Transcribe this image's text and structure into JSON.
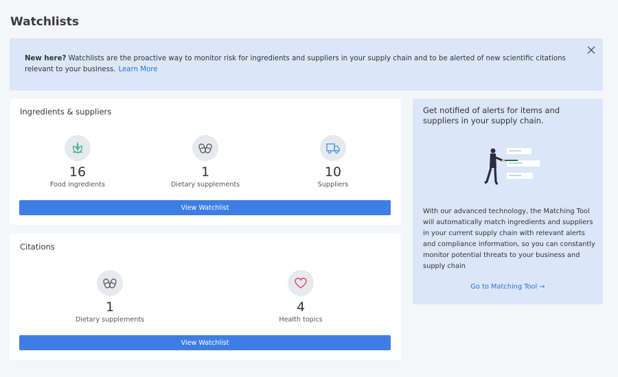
{
  "page": {
    "title": "Watchlists"
  },
  "banner": {
    "bold": "New here?",
    "text": " Watchlists are the proactive way to monitor risk for ingredients and suppliers in your supply chain and to be alerted of new scientific citations relevant to your business.",
    "link": "Learn More"
  },
  "ingredients": {
    "title": "Ingredients & suppliers",
    "stats": [
      {
        "value": "16",
        "label": "Food ingredients",
        "icon": "leaf-icon"
      },
      {
        "value": "1",
        "label": "Dietary supplements",
        "icon": "pills-icon"
      },
      {
        "value": "10",
        "label": "Suppliers",
        "icon": "truck-icon"
      }
    ],
    "button": "View Watchlist"
  },
  "citations": {
    "title": "Citations",
    "stats": [
      {
        "value": "1",
        "label": "Dietary supplements",
        "icon": "pills-icon"
      },
      {
        "value": "4",
        "label": "Health topics",
        "icon": "heart-icon"
      }
    ],
    "button": "View Watchlist"
  },
  "side": {
    "title": "Get notified of alerts for items and suppliers in your supply chain.",
    "body": "With our advanced technology, the Matching Tool will automatically match ingredients and suppliers in your current supply chain with relevant alerts and compliance information, so you can constantly monitor potential threats to your business and supply chain",
    "link": "Go to Matching Tool →"
  },
  "colors": {
    "accent": "#3e7ee4",
    "banner_bg": "#dbe6f7",
    "leaf": "#3fb27f",
    "truck": "#3e8fe4",
    "heart": "#e0435a"
  }
}
